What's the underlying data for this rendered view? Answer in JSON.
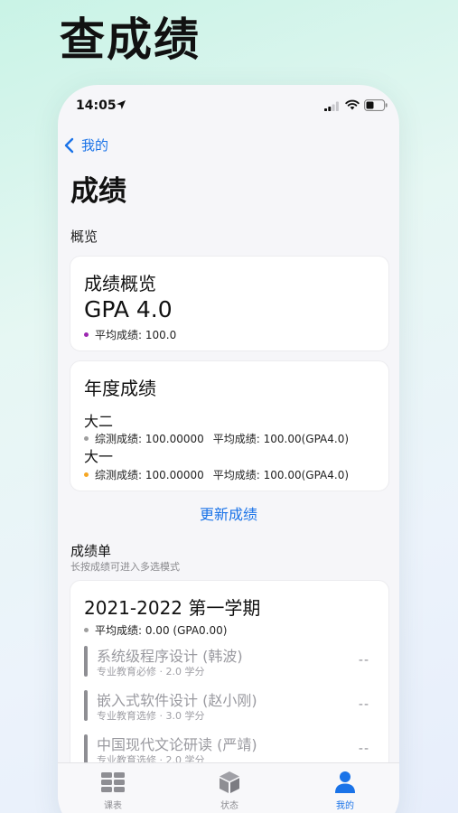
{
  "headline": "查成绩",
  "statusbar": {
    "time": "14:05"
  },
  "nav": {
    "back_label": "我的"
  },
  "page": {
    "title": "成绩",
    "section": "概览"
  },
  "overview": {
    "title": "成绩概览",
    "gpa": "GPA 4.0",
    "avg": "平均成绩: 100.0",
    "dot_color": "#9c27b0"
  },
  "yearly": {
    "title": "年度成绩",
    "years": [
      {
        "name": "大二",
        "comprehensive": "综测成绩: 100.00000",
        "average": "平均成绩: 100.00(GPA4.0)",
        "dot_color": "#9e9e9e"
      },
      {
        "name": "大一",
        "comprehensive": "综测成绩: 100.00000",
        "average": "平均成绩: 100.00(GPA4.0)",
        "dot_color": "#f5a623"
      }
    ]
  },
  "update_button": "更新成绩",
  "transcript": {
    "title": "成绩单",
    "hint": "长按成绩可进入多选模式",
    "term": {
      "title": "2021-2022 第一学期",
      "avg": "平均成绩: 0.00 (GPA0.00)",
      "courses": [
        {
          "name": "系统级程序设计 (韩波)",
          "info": "专业教育必修 · 2.0 学分",
          "score": "--"
        },
        {
          "name": "嵌入式软件设计 (赵小刚)",
          "info": "专业教育选修 · 3.0 学分",
          "score": "--"
        },
        {
          "name": "中国现代文论研读 (严靖)",
          "info": "专业教育选修 · 2.0 学分",
          "score": "--"
        }
      ]
    }
  },
  "tabbar": {
    "tabs": [
      {
        "label": "课表",
        "icon": "grid-icon"
      },
      {
        "label": "状态",
        "icon": "cube-icon"
      },
      {
        "label": "我的",
        "icon": "person-icon",
        "active": true
      }
    ]
  },
  "colors": {
    "accent": "#1a73e8"
  }
}
